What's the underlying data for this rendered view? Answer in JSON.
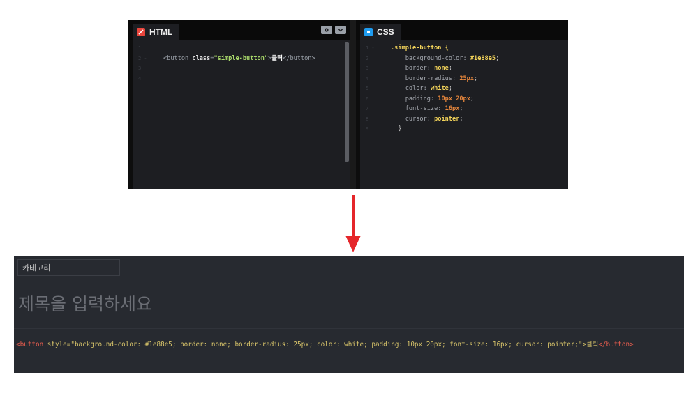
{
  "editor": {
    "html_panel": {
      "tab_label": "HTML",
      "line_numbers": [
        "1",
        "2 -",
        "3",
        "4"
      ],
      "code": {
        "line2_open": "<button ",
        "line2_attr": "class",
        "line2_eq": "=",
        "line2_value": "\"simple-button\"",
        "line2_close_bracket": ">",
        "line2_text": "클릭",
        "line2_end_tag": "</button>"
      }
    },
    "css_panel": {
      "tab_label": "CSS",
      "line_numbers": [
        "1 -",
        "2",
        "3",
        "4",
        "5",
        "6",
        "7",
        "8",
        "9"
      ],
      "selector": ".simple-button {",
      "rules": [
        {
          "property": "background-color:",
          "value": "#1e88e5",
          "type": "val"
        },
        {
          "property": "border:",
          "value": "none",
          "type": "val"
        },
        {
          "property": "border-radius:",
          "value": "25px",
          "type": "num"
        },
        {
          "property": "color:",
          "value": "white",
          "type": "val"
        },
        {
          "property": "padding:",
          "value": "10px 20px",
          "type": "num"
        },
        {
          "property": "font-size:",
          "value": "16px",
          "type": "num"
        },
        {
          "property": "cursor:",
          "value": "pointer",
          "type": "val"
        }
      ],
      "semicolon": ";",
      "closing": "}"
    }
  },
  "preview": {
    "category_placeholder": "카테고리",
    "title_placeholder": "제목을 입력하세요",
    "result": {
      "open_tag": "<button ",
      "attr": "style=\"background-color: #1e88e5; border: none; border-radius: 25px; color: white; padding: 10px 20px; font-size: 16px; cursor: pointer;\">",
      "text": "클릭",
      "close_tag": "</button>"
    }
  },
  "colors": {
    "arrow": "#e5262a",
    "html_icon": "#e8453c",
    "css_icon": "#1f9cf0"
  },
  "icons": {
    "html_tab": "html5-icon",
    "css_tab": "css3-icon",
    "settings": "gear-icon",
    "collapse": "chevron-down-icon",
    "arrow": "arrow-down-icon"
  }
}
